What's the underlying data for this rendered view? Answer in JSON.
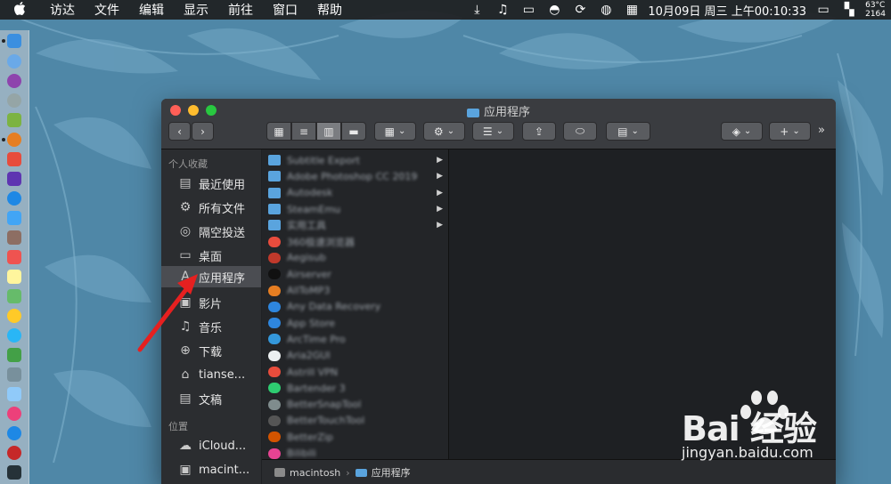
{
  "menubar": {
    "apple_icon": "apple-icon",
    "items": [
      "访达",
      "文件",
      "编辑",
      "显示",
      "前往",
      "窗口",
      "帮助"
    ],
    "clock": "10月09日 周三 上午00:10:33",
    "weather_temp": "63°C",
    "weather_value": "2164",
    "status_icons": [
      "download-icon",
      "music-icon",
      "display-icon",
      "ghost-icon",
      "sync-icon",
      "globe-icon",
      "calendar-icon"
    ]
  },
  "window": {
    "title": "应用程序"
  },
  "sidebar": {
    "favorites_header": "个人收藏",
    "items": [
      {
        "label": "最近使用",
        "icon": "recents-icon"
      },
      {
        "label": "所有文件",
        "icon": "gear-icon"
      },
      {
        "label": "隔空投送",
        "icon": "airdrop-icon"
      },
      {
        "label": "桌面",
        "icon": "desktop-icon"
      },
      {
        "label": "应用程序",
        "icon": "applications-icon"
      },
      {
        "label": "影片",
        "icon": "movies-icon"
      },
      {
        "label": "音乐",
        "icon": "music-icon"
      },
      {
        "label": "下载",
        "icon": "downloads-icon"
      },
      {
        "label": "tianse...",
        "icon": "home-icon"
      },
      {
        "label": "文稿",
        "icon": "documents-icon"
      }
    ],
    "locations_header": "位置",
    "locations": [
      {
        "label": "iCloud...",
        "icon": "cloud-icon"
      },
      {
        "label": "macint...",
        "icon": "disk-icon"
      }
    ]
  },
  "files": [
    {
      "name": "Subtitle Export",
      "color": "#5aa4de",
      "folder": true
    },
    {
      "name": "Adobe Photoshop CC 2019",
      "color": "#5aa4de",
      "folder": true
    },
    {
      "name": "Autodesk",
      "color": "#5aa4de",
      "folder": true
    },
    {
      "name": "SteamEmu",
      "color": "#5aa4de",
      "folder": true
    },
    {
      "name": "实用工具",
      "color": "#5aa4de",
      "folder": true
    },
    {
      "name": "360极速浏览器",
      "color": "#e84c3d",
      "folder": false
    },
    {
      "name": "Aegisub",
      "color": "#c0392b",
      "folder": false
    },
    {
      "name": "Airserver",
      "color": "#111111",
      "folder": false
    },
    {
      "name": "AllToMP3",
      "color": "#e67e22",
      "folder": false
    },
    {
      "name": "Any Data Recovery",
      "color": "#2e86de",
      "folder": false
    },
    {
      "name": "App Store",
      "color": "#2e86de",
      "folder": false
    },
    {
      "name": "ArcTime Pro",
      "color": "#3498db",
      "folder": false
    },
    {
      "name": "Aria2GUI",
      "color": "#ecf0f1",
      "folder": false
    },
    {
      "name": "Astrill VPN",
      "color": "#e74c3c",
      "folder": false
    },
    {
      "name": "Bartender 3",
      "color": "#2ecc71",
      "folder": false
    },
    {
      "name": "BetterSnapTool",
      "color": "#7f8c8d",
      "folder": false
    },
    {
      "name": "BetterTouchTool",
      "color": "#555555",
      "folder": false
    },
    {
      "name": "BetterZip",
      "color": "#d35400",
      "folder": false
    },
    {
      "name": "Bilibili",
      "color": "#e84393",
      "folder": false
    }
  ],
  "pathbar": {
    "disk": "macintosh",
    "folder": "应用程序"
  },
  "watermark": {
    "line1": "Bai 经验",
    "line2": "jingyan.baidu.com"
  }
}
